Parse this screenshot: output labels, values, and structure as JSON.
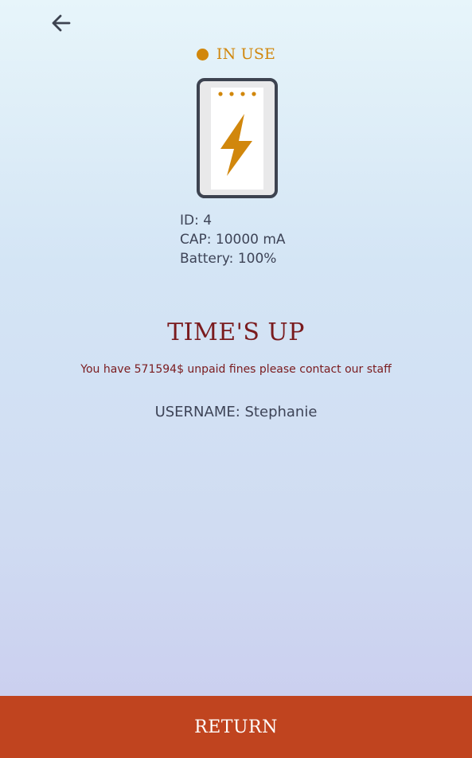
{
  "nav": {
    "back_icon": "arrow-left-icon"
  },
  "status": {
    "label": "IN USE",
    "color": "#d1870c"
  },
  "device": {
    "icon": "power-bank-lightning-icon",
    "accent": "#d1870c",
    "frame": "#3d4350"
  },
  "info": {
    "id": "ID: 4",
    "capacity": "CAP: 10000 mA",
    "battery": "Battery: 100%"
  },
  "alert": {
    "title": "TIME'S UP",
    "message": "You have 571594$ unpaid fines please contact our staff",
    "color": "#7a1b1e"
  },
  "user": {
    "username": "USERNAME: Stephanie"
  },
  "actions": {
    "return_label": "RETURN",
    "color": "#c0441f"
  }
}
